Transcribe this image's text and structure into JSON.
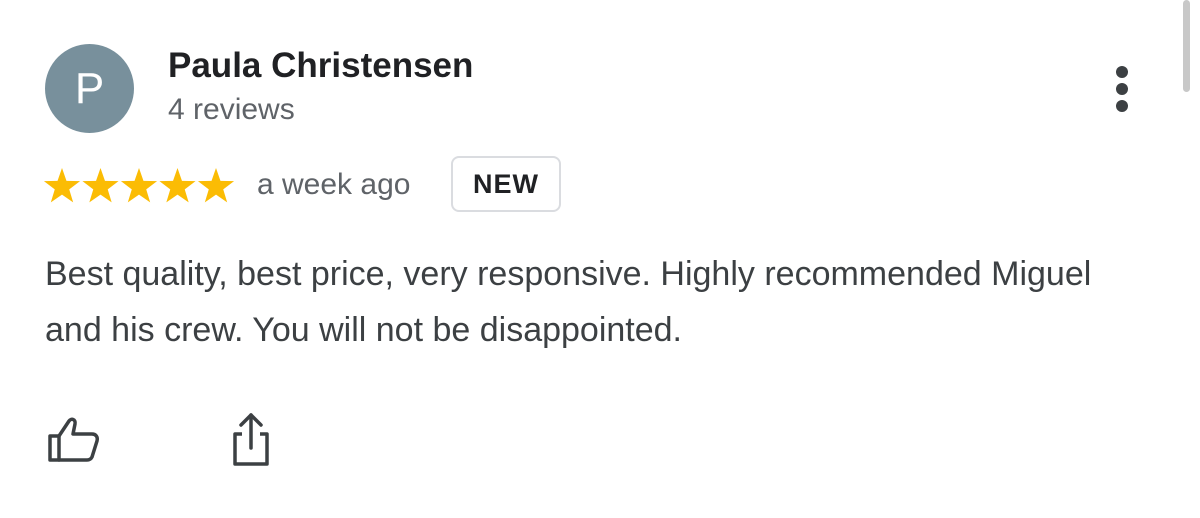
{
  "reviewer": {
    "initial": "P",
    "name": "Paula Christensen",
    "review_count": "4 reviews",
    "avatar_color": "#78909c"
  },
  "rating": {
    "stars": 5,
    "max_stars": 5,
    "star_color": "#fbbc04"
  },
  "time_ago": "a week ago",
  "badge": "NEW",
  "review_text": "Best quality, best price, very responsive. Highly recommended Miguel and his crew. You will not be disappointed.",
  "actions": {
    "more_icon": "more-vertical-icon",
    "like_icon": "thumb-up-icon",
    "share_icon": "share-icon"
  }
}
